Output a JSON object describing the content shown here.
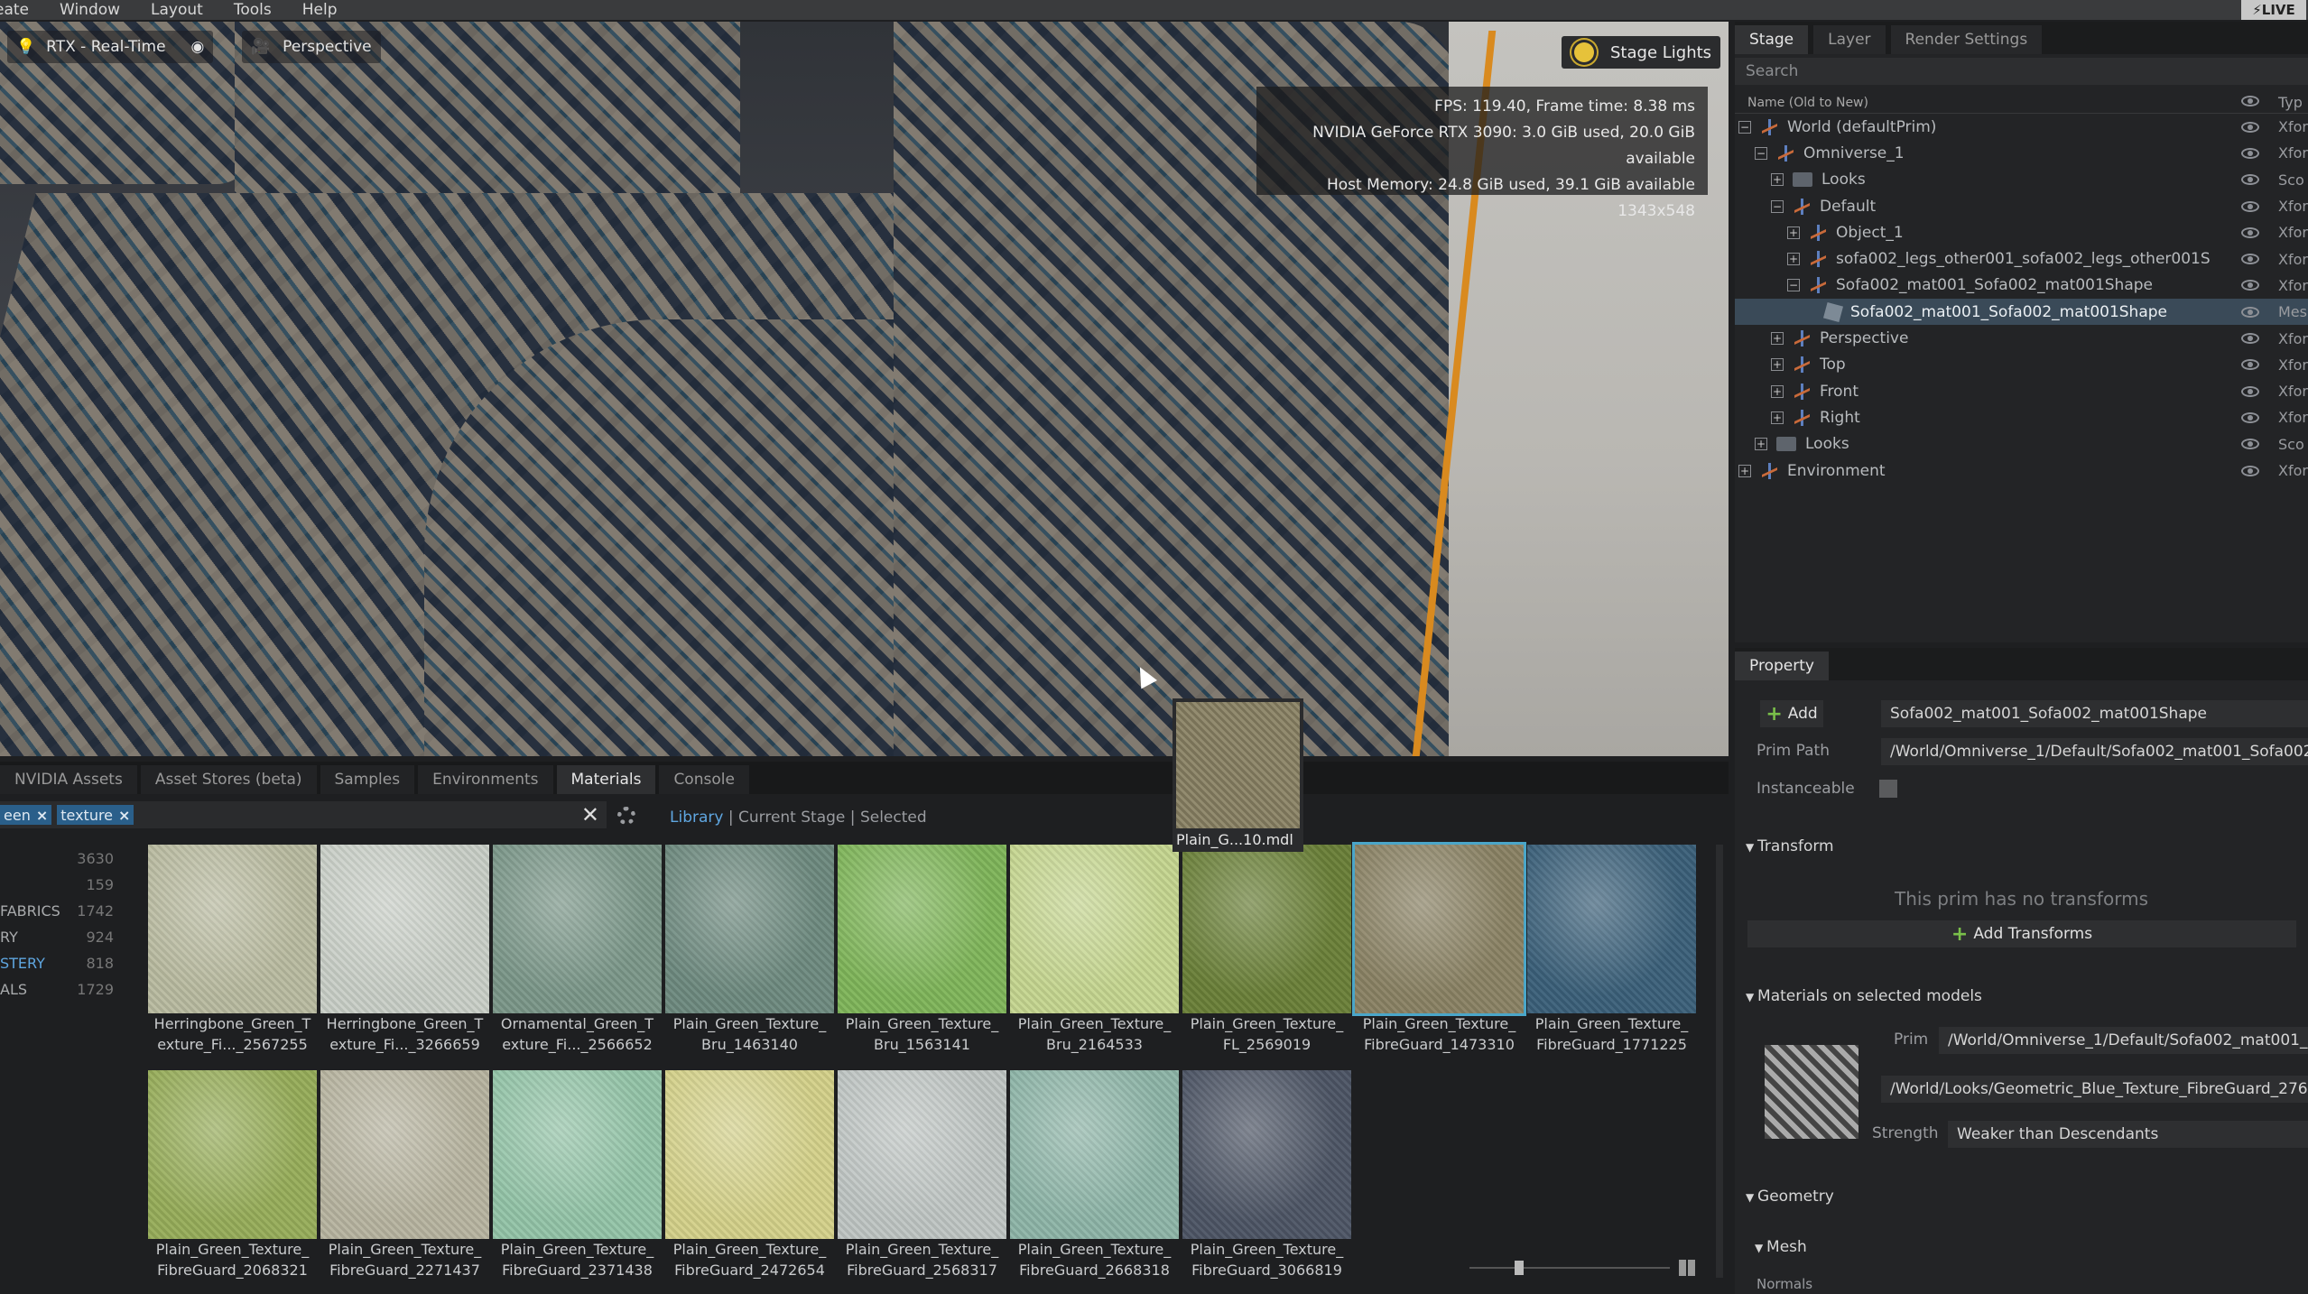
{
  "menu": [
    "eate",
    "Window",
    "Layout",
    "Tools",
    "Help"
  ],
  "live_label": "LIVE",
  "viewport": {
    "renderer": "RTX - Real-Time",
    "camera": "Perspective",
    "stage_lights": "Stage Lights",
    "stats": [
      "FPS: 119.40, Frame time: 8.38 ms",
      "NVIDIA GeForce RTX 3090: 3.0 GiB used, 20.0 GiB available",
      "Host Memory: 24.8 GiB used, 39.1 GiB available",
      "1343x548"
    ],
    "drag_item": "Plain_G...10.mdl"
  },
  "stage": {
    "tabs": [
      "Stage",
      "Layer",
      "Render Settings"
    ],
    "search_placeholder": "Search",
    "column": "Name (Old to New)",
    "type_col": "Typ",
    "rows": [
      {
        "label": "World (defaultPrim)",
        "exp": "−",
        "icon": "xform",
        "type": "Xfor"
      },
      {
        "label": "Omniverse_1",
        "exp": "−",
        "icon": "xform",
        "type": "Xfor"
      },
      {
        "label": "Looks",
        "exp": "+",
        "icon": "folder",
        "type": "Sco"
      },
      {
        "label": "Default",
        "exp": "−",
        "icon": "xform",
        "type": "Xfor"
      },
      {
        "label": "Object_1",
        "exp": "+",
        "icon": "xform",
        "type": "Xfor"
      },
      {
        "label": "sofa002_legs_other001_sofa002_legs_other001S",
        "exp": "+",
        "icon": "xform",
        "type": "Xfor"
      },
      {
        "label": "Sofa002_mat001_Sofa002_mat001Shape",
        "exp": "−",
        "icon": "xform",
        "type": "Xfor"
      },
      {
        "label": "Sofa002_mat001_Sofa002_mat001Shape",
        "exp": "",
        "icon": "mesh",
        "type": "Mes"
      },
      {
        "label": "Perspective",
        "exp": "+",
        "icon": "xform",
        "type": "Xfor"
      },
      {
        "label": "Top",
        "exp": "+",
        "icon": "xform",
        "type": "Xfor"
      },
      {
        "label": "Front",
        "exp": "+",
        "icon": "xform",
        "type": "Xfor"
      },
      {
        "label": "Right",
        "exp": "+",
        "icon": "xform",
        "type": "Xfor"
      },
      {
        "label": "Looks",
        "exp": "+",
        "icon": "folder",
        "type": "Sco"
      },
      {
        "label": "Environment",
        "exp": "+",
        "icon": "xform",
        "type": "Xfor"
      }
    ]
  },
  "property": {
    "tab": "Property",
    "add": "Add",
    "prim_name": "Sofa002_mat001_Sofa002_mat001Shape",
    "prim_path_label": "Prim Path",
    "prim_path": "/World/Omniverse_1/Default/Sofa002_mat001_Sofa002",
    "instanceable_label": "Instanceable",
    "transform_header": "Transform",
    "no_transforms": "This prim has no transforms",
    "add_transforms": "Add Transforms",
    "materials_header": "Materials on selected models",
    "prim_label": "Prim",
    "prim_value": "/World/Omniverse_1/Default/Sofa002_mat001_",
    "material_path": "/World/Looks/Geometric_Blue_Texture_FibreGuard_276",
    "strength_label": "Strength",
    "strength_value": "Weaker than Descendants",
    "geometry_header": "Geometry",
    "mesh_header": "Mesh",
    "normals_label": "Normals"
  },
  "browser": {
    "tabs": [
      "NVIDIA Assets",
      "Asset Stores (beta)",
      "Samples",
      "Environments",
      "Materials",
      "Console"
    ],
    "chips": [
      "een",
      "texture"
    ],
    "sources": [
      "Library",
      "Current Stage",
      "Selected"
    ],
    "categories": [
      {
        "name": "",
        "count": "3630"
      },
      {
        "name": "",
        "count": "159"
      },
      {
        "name": "FABRICS",
        "count": "1742"
      },
      {
        "name": "RY",
        "count": "924"
      },
      {
        "name": "STERY",
        "count": "818"
      },
      {
        "name": "ALS",
        "count": "1729"
      }
    ],
    "materials": [
      {
        "l1": "Herringbone_Green_T",
        "l2": "exture_Fi..._2567255",
        "color": "#b9bba0"
      },
      {
        "l1": "Herringbone_Green_T",
        "l2": "exture_Fi..._3266659",
        "color": "#c9cfc7"
      },
      {
        "l1": "Ornamental_Green_T",
        "l2": "exture_Fi..._2566652",
        "color": "#7b9789"
      },
      {
        "l1": "Plain_Green_Texture_",
        "l2": "Bru_1463140",
        "color": "#6e8a7f"
      },
      {
        "l1": "Plain_Green_Texture_",
        "l2": "Bru_1563141",
        "color": "#7fb55a"
      },
      {
        "l1": "Plain_Green_Texture_",
        "l2": "Bru_2164533",
        "color": "#c5d690"
      },
      {
        "l1": "Plain_Green_Texture_",
        "l2": "FL_2569019",
        "color": "#6a8038"
      },
      {
        "l1": "Plain_Green_Texture_",
        "l2": "FibreGuard_1473310",
        "color": "#8a8264"
      },
      {
        "l1": "Plain_Green_Texture_",
        "l2": "FibreGuard_1771225",
        "color": "#3b6079"
      },
      {
        "l1": "Plain_Green_Texture_",
        "l2": "FibreGuard_2068321",
        "color": "#97ad5a"
      },
      {
        "l1": "Plain_Green_Texture_",
        "l2": "FibreGuard_2271437",
        "color": "#b7b4a0"
      },
      {
        "l1": "Plain_Green_Texture_",
        "l2": "FibreGuard_2371438",
        "color": "#94c4a8"
      },
      {
        "l1": "Plain_Green_Texture_",
        "l2": "FibreGuard_2472654",
        "color": "#d4d18a"
      },
      {
        "l1": "Plain_Green_Texture_",
        "l2": "FibreGuard_2568317",
        "color": "#bfc5c3"
      },
      {
        "l1": "Plain_Green_Texture_",
        "l2": "FibreGuard_2668318",
        "color": "#8eb5a8"
      },
      {
        "l1": "Plain_Green_Texture_",
        "l2": "FibreGuard_3066819",
        "color": "#4d5565"
      }
    ],
    "selected_index": 7
  }
}
